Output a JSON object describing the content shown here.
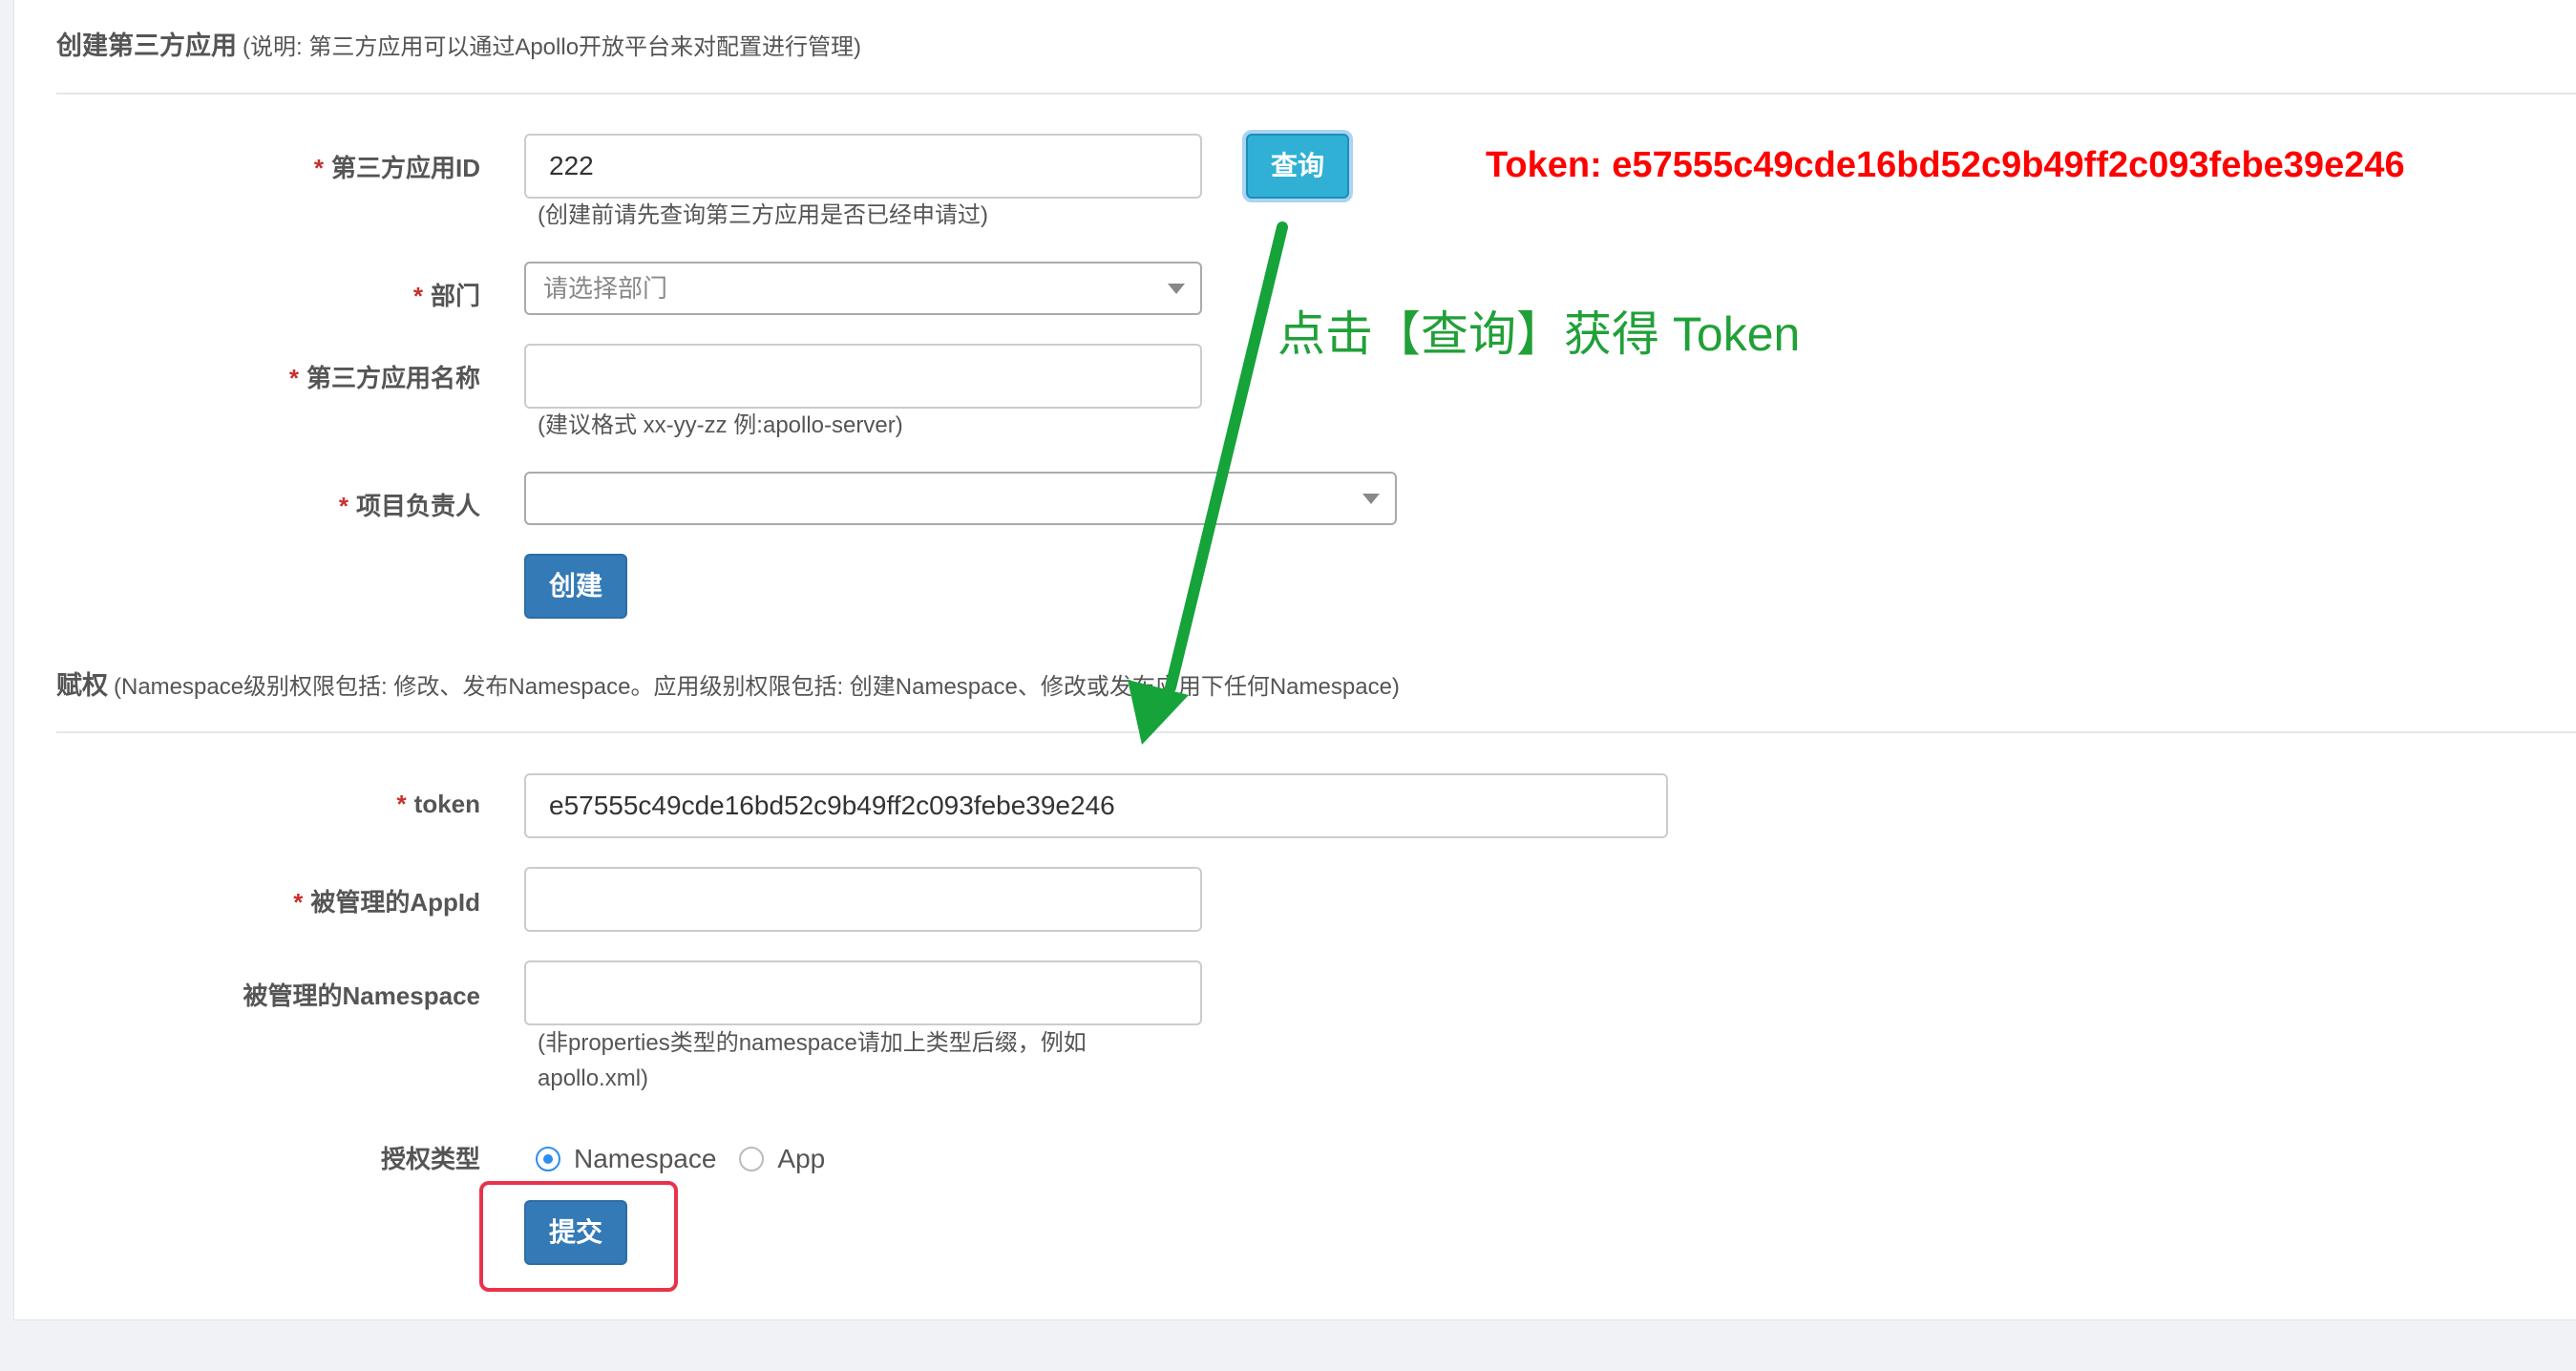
{
  "create_section": {
    "title": "创建第三方应用",
    "note": "(说明: 第三方应用可以通过Apollo开放平台来对配置进行管理)"
  },
  "form": {
    "app_id": {
      "required": "*",
      "label": "第三方应用ID",
      "value": "222",
      "help": "(创建前请先查询第三方应用是否已经申请过)"
    },
    "query_button": "查询",
    "department": {
      "required": "*",
      "label": "部门",
      "placeholder": "请选择部门"
    },
    "app_name": {
      "required": "*",
      "label": "第三方应用名称",
      "value": "",
      "help": "(建议格式 xx-yy-zz 例:apollo-server)"
    },
    "owner": {
      "required": "*",
      "label": "项目负责人",
      "value": ""
    },
    "create_button": "创建"
  },
  "grant_section": {
    "title": "赋权",
    "note": "(Namespace级别权限包括: 修改、发布Namespace。应用级别权限包括: 创建Namespace、修改或发布应用下任何Namespace)"
  },
  "grant": {
    "token": {
      "required": "*",
      "label": "token",
      "value": "e57555c49cde16bd52c9b49ff2c093febe39e246"
    },
    "managed_appid": {
      "required": "*",
      "label": "被管理的AppId",
      "value": ""
    },
    "managed_namespace": {
      "label": "被管理的Namespace",
      "value": "",
      "help_line1": "(非properties类型的namespace请加上类型后缀，例如",
      "help_line2": "apollo.xml)"
    },
    "auth_type": {
      "label": "授权类型",
      "options": [
        "Namespace",
        "App"
      ],
      "selected": "Namespace"
    },
    "submit_button": "提交"
  },
  "annotations": {
    "token_text": "Token: e57555c49cde16bd52c9b49ff2c093febe39e246",
    "hint_text": "点击【查询】获得 Token",
    "token_color": "#ff0000",
    "hint_color": "#21a038",
    "box_color": "#e8334a"
  },
  "colors": {
    "primary": "#337ab7",
    "info": "#31b0d5",
    "required": "#c9302c",
    "radio_checked": "#2d8cf0"
  }
}
